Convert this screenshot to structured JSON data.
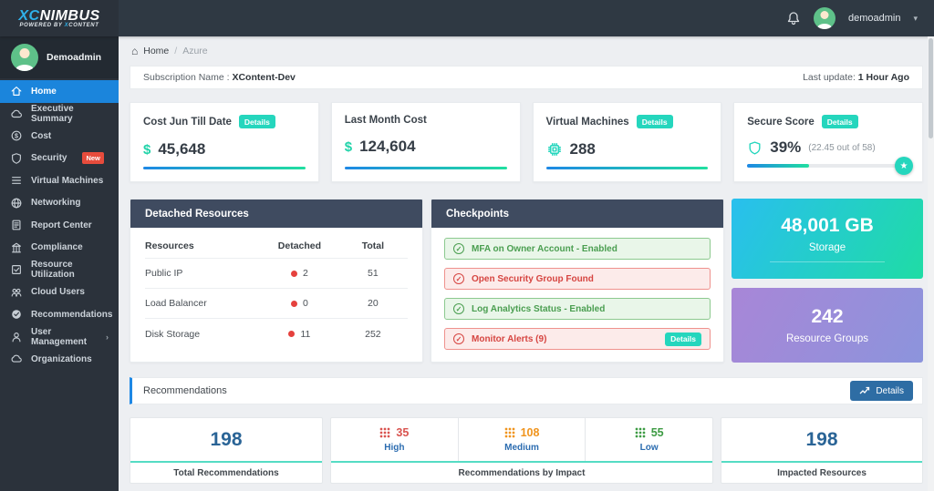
{
  "brand": {
    "logo_x": "XC",
    "logo_rest": "NIMBUS",
    "tagline": "POWERED BY ",
    "tagline_x": "X",
    "tagline_rest": "CONTENT"
  },
  "topbar": {
    "username": "demoadmin",
    "caret": "▾"
  },
  "sidebar": {
    "profile_name": "Demoadmin",
    "items": [
      {
        "label": "Home"
      },
      {
        "label": "Executive Summary"
      },
      {
        "label": "Cost"
      },
      {
        "label": "Security",
        "badge": "New"
      },
      {
        "label": "Virtual Machines"
      },
      {
        "label": "Networking"
      },
      {
        "label": "Report Center"
      },
      {
        "label": "Compliance"
      },
      {
        "label": "Resource Utilization"
      },
      {
        "label": "Cloud Users"
      },
      {
        "label": "Recommendations"
      },
      {
        "label": "User Management",
        "chevron": "›"
      },
      {
        "label": "Organizations"
      }
    ]
  },
  "breadcrumb": {
    "home_icon": "⌂",
    "home": "Home",
    "separator": "/",
    "current": "Azure"
  },
  "subscription": {
    "label": "Subscription Name :",
    "value": "XContent-Dev",
    "update_label": "Last update:",
    "update_value": "1 Hour Ago"
  },
  "stats": {
    "cost_till_date": {
      "title": "Cost Jun Till Date",
      "badge": "Details",
      "currency": "$",
      "value": "45,648"
    },
    "last_month": {
      "title": "Last Month Cost",
      "currency": "$",
      "value": "124,604"
    },
    "vms": {
      "title": "Virtual Machines",
      "badge": "Details",
      "value": "288"
    },
    "secure_score": {
      "title": "Secure Score",
      "badge": "Details",
      "percent": "39%",
      "detail": "(22.45 out of 58)",
      "progress_pct": 39,
      "star": "★"
    }
  },
  "detached": {
    "title": "Detached Resources",
    "columns": [
      "Resources",
      "Detached",
      "Total"
    ],
    "rows": [
      [
        "Public IP",
        "2",
        "51"
      ],
      [
        "Load Balancer",
        "0",
        "20"
      ],
      [
        "Disk Storage",
        "11",
        "252"
      ]
    ]
  },
  "checkpoints": {
    "title": "Checkpoints",
    "check_glyph": "✓",
    "items": [
      {
        "label": "MFA on Owner Account - Enabled",
        "status": "ok"
      },
      {
        "label": "Open Security Group Found",
        "status": "alert"
      },
      {
        "label": "Log Analytics Status - Enabled",
        "status": "ok"
      },
      {
        "label": "Monitor Alerts (9)",
        "status": "alert",
        "badge": "Details"
      }
    ]
  },
  "storage": {
    "value": "48,001 GB",
    "label": "Storage"
  },
  "resource_groups": {
    "value": "242",
    "label": "Resource Groups"
  },
  "recommendations": {
    "title": "Recommendations",
    "details_button": "Details",
    "total": {
      "value": "198",
      "label": "Total Recommendations"
    },
    "impact": {
      "label": "Recommendations by Impact",
      "items": [
        {
          "value": "35",
          "label": "High",
          "color": "#d9534f"
        },
        {
          "value": "108",
          "label": "Medium",
          "color": "#f0941d"
        },
        {
          "value": "55",
          "label": "Low",
          "color": "#3d9b43"
        }
      ]
    },
    "impacted": {
      "value": "198",
      "label": "Impacted Resources"
    }
  },
  "colors": {
    "accent_teal": "#25d6bd",
    "accent_blue": "#1e88e5",
    "header_navy": "#3f4b60",
    "active_item_blue": "#1b85dc",
    "alert_red": "#d64541",
    "ok_green": "#4a9e50"
  }
}
